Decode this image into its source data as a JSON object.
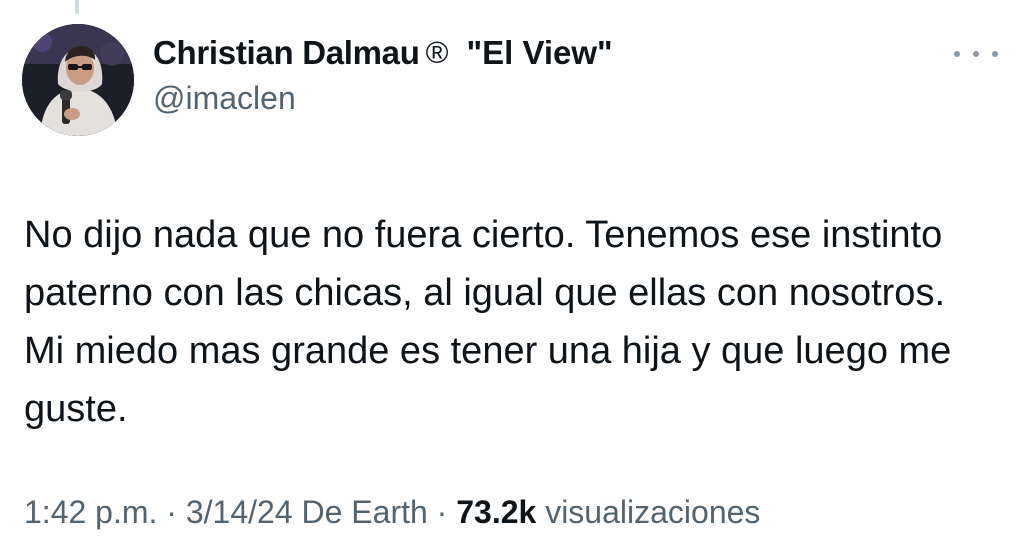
{
  "author": {
    "display_name": "Christian Dalmau",
    "registered_mark": "®",
    "name_suffix": "\"El View\"",
    "handle": "@imaclen",
    "avatar_icon": "profile-photo-person-hoodie-microphone"
  },
  "tweet": {
    "text": "No dijo nada que no fuera cierto. Tenemos ese instinto paterno con las chicas, al igual que ellas con nosotros. Mi miedo mas grande es tener una hija y que luego me guste."
  },
  "meta": {
    "time": "1:42 p.m.",
    "separator": "·",
    "date": "3/14/24",
    "source": "De Earth",
    "views_count": "73.2k",
    "views_label": "visualizaciones"
  },
  "more_icon": "more-horizontal-icon",
  "colors": {
    "text_primary": "#0f1419",
    "text_secondary": "#536471",
    "icon_gray": "#8b98a5",
    "background": "#ffffff"
  }
}
